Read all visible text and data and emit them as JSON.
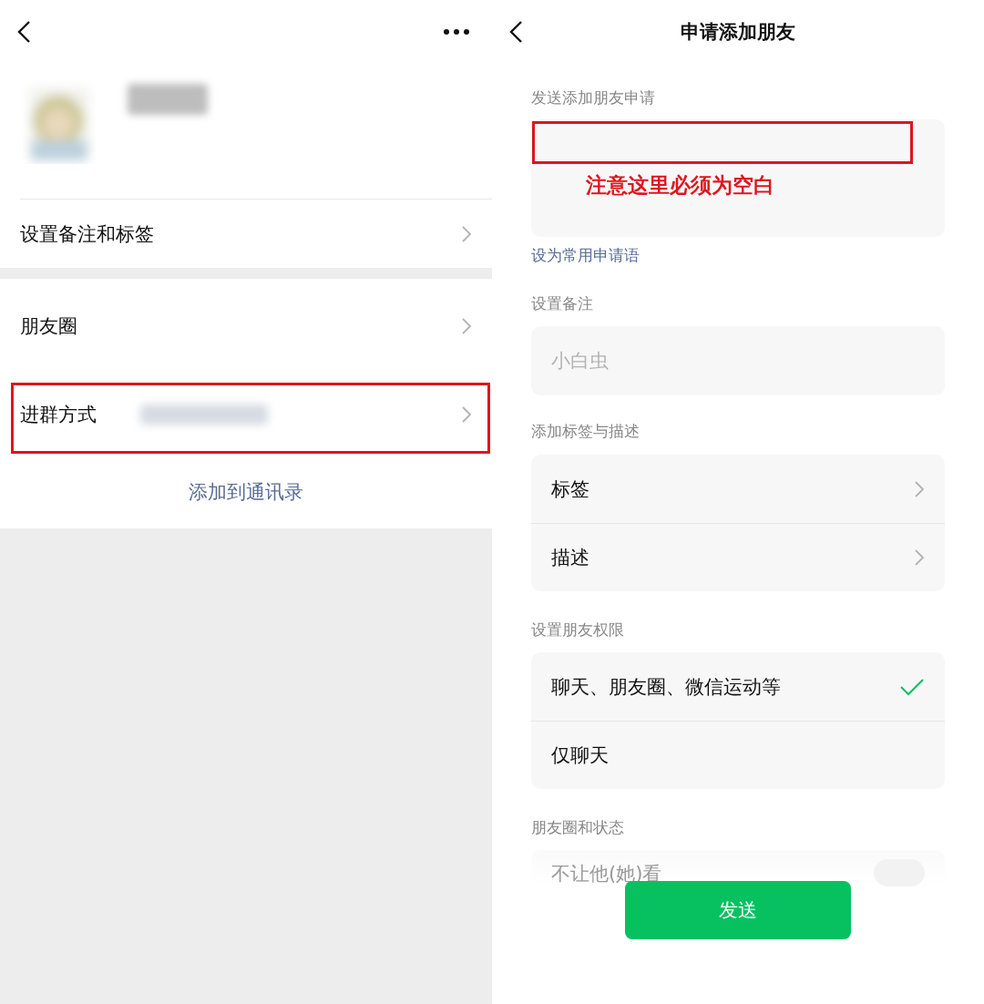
{
  "left": {
    "profile": {
      "name_blurred": true
    },
    "sections": [
      {
        "rows": [
          {
            "label": "设置备注和标签",
            "value_blurred": false,
            "highlighted": false
          }
        ]
      },
      {
        "rows": [
          {
            "label": "朋友圈",
            "value_blurred": false,
            "highlighted": false
          },
          {
            "label": "进群方式",
            "value_blurred": true,
            "highlighted": true
          }
        ]
      }
    ],
    "action": "添加到通讯录"
  },
  "right": {
    "title": "申请添加朋友",
    "message": {
      "label": "发送添加朋友申请",
      "highlighted": true,
      "annotation": "注意这里必须为空白"
    },
    "link": "设为常用申请语",
    "remark": {
      "label": "设置备注",
      "placeholder": "小白虫"
    },
    "tags": {
      "label": "添加标签与描述",
      "rows": [
        "标签",
        "描述"
      ]
    },
    "permissions": {
      "label": "设置朋友权限",
      "options": [
        {
          "label": "聊天、朋友圈、微信运动等",
          "selected": true
        },
        {
          "label": "仅聊天",
          "selected": false
        }
      ]
    },
    "moments": {
      "label": "朋友圈和状态",
      "rows": [
        {
          "label": "不让他(她)看",
          "on": false
        }
      ]
    },
    "button": "发送"
  }
}
